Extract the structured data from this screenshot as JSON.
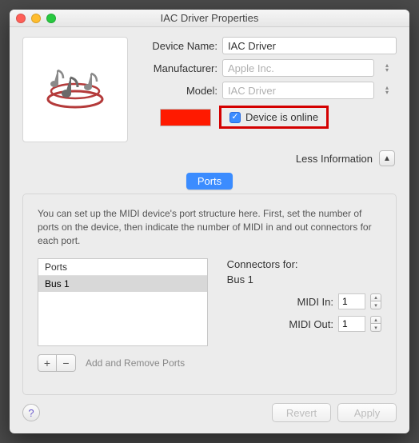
{
  "window": {
    "title": "IAC Driver Properties"
  },
  "form": {
    "device_name_label": "Device Name:",
    "device_name_value": "IAC Driver",
    "manufacturer_label": "Manufacturer:",
    "manufacturer_value": "Apple Inc.",
    "model_label": "Model:",
    "model_value": "IAC Driver",
    "color_hex": "#ff1a00",
    "online_label": "Device is online",
    "online_checked": true
  },
  "disclosure": {
    "label": "Less Information",
    "glyph": "▲"
  },
  "tabs": {
    "active": "Ports"
  },
  "panel": {
    "description": "You can set up the MIDI device's port structure here.  First, set the number of ports on the device, then indicate the number of MIDI in and out connectors for each port.",
    "ports_header": "Ports",
    "ports": [
      "Bus 1"
    ],
    "selected_port": "Bus 1",
    "add_remove_hint": "Add and Remove Ports",
    "connectors_title": "Connectors for:",
    "midi_in_label": "MIDI In:",
    "midi_in_value": "1",
    "midi_out_label": "MIDI Out:",
    "midi_out_value": "1"
  },
  "buttons": {
    "help": "?",
    "revert": "Revert",
    "apply": "Apply",
    "plus": "+",
    "minus": "−"
  }
}
